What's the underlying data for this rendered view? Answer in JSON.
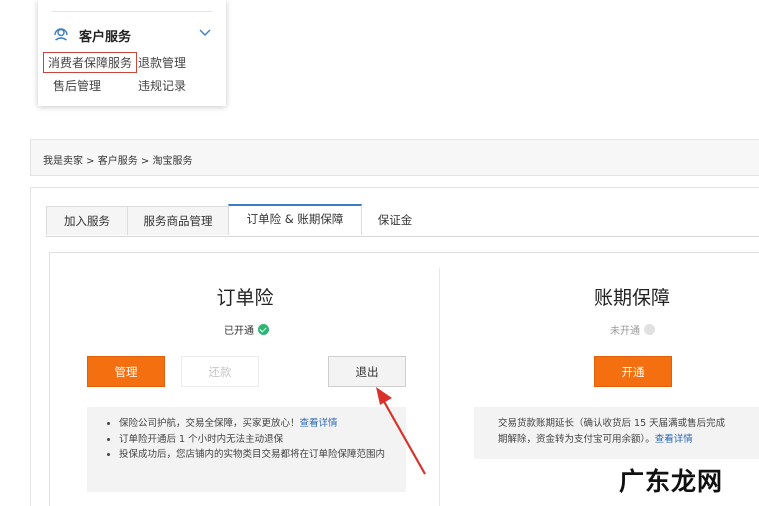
{
  "menu": {
    "title": "客户服务",
    "items": [
      "消费者保障服务",
      "退款管理",
      "售后管理",
      "违规记录"
    ]
  },
  "breadcrumb": {
    "text": "我是卖家 > 客户服务 > 淘宝服务"
  },
  "tabs": [
    {
      "label": "加入服务"
    },
    {
      "label": "服务商品管理"
    },
    {
      "label": "订单险 & 账期保障"
    },
    {
      "label": "保证金"
    }
  ],
  "order_insurance": {
    "title": "订单险",
    "status": "已开通",
    "buttons": {
      "manage": "管理",
      "repay": "还款",
      "exit": "退出"
    },
    "notes": [
      {
        "text": "保险公司护航，交易全保障，买家更放心！",
        "link": "查看详情"
      },
      {
        "text": "订单险开通后 1 个小时内无法主动退保",
        "link": ""
      },
      {
        "text": "投保成功后，您店铺内的实物类目交易都将在订单险保障范围内",
        "link": ""
      }
    ]
  },
  "billing_guarantee": {
    "title": "账期保障",
    "status": "未开通",
    "button": "开通",
    "note": "交易货款账期延长（确认收货后 15 天届满或售后完成",
    "note2": "期解除，资金转为支付宝可用余额）。",
    "link": "查看详情"
  },
  "watermark": "广东龙网",
  "colors": {
    "accent_orange": "#f36f0f",
    "tab_active": "#3c7ec4",
    "link": "#2a68b6",
    "success": "#2bb673",
    "highlight_box": "#c9453c",
    "arrow": "#d9312b"
  }
}
